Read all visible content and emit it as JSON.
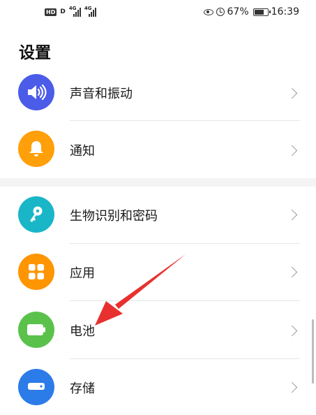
{
  "status_bar": {
    "hd_badge": "HD",
    "d_badge": "D",
    "network_1": "4G",
    "network_2": "4G",
    "battery_percent": "67%",
    "time": "16:39",
    "icons": [
      "eye-icon",
      "alarm-icon",
      "battery-icon"
    ]
  },
  "page": {
    "title": "设置"
  },
  "settings_groups": [
    {
      "items": [
        {
          "label": "声音和振动",
          "icon": "speaker-icon",
          "color": "#4a5ce8"
        },
        {
          "label": "通知",
          "icon": "bell-icon",
          "color": "#ff9f0a"
        }
      ]
    },
    {
      "items": [
        {
          "label": "生物识别和密码",
          "icon": "key-icon",
          "color": "#19b6c7"
        },
        {
          "label": "应用",
          "icon": "apps-grid-icon",
          "color": "#ff9500"
        },
        {
          "label": "电池",
          "icon": "battery-icon",
          "color": "#5ac24b"
        },
        {
          "label": "存储",
          "icon": "storage-icon",
          "color": "#2b7be8"
        }
      ]
    }
  ],
  "annotation": {
    "type": "red-arrow",
    "points_to": "电池",
    "color": "#e8312f"
  },
  "colors": {
    "background": "#ffffff",
    "section_gap": "#f4f4f4",
    "chevron": "#9a9a9a"
  }
}
